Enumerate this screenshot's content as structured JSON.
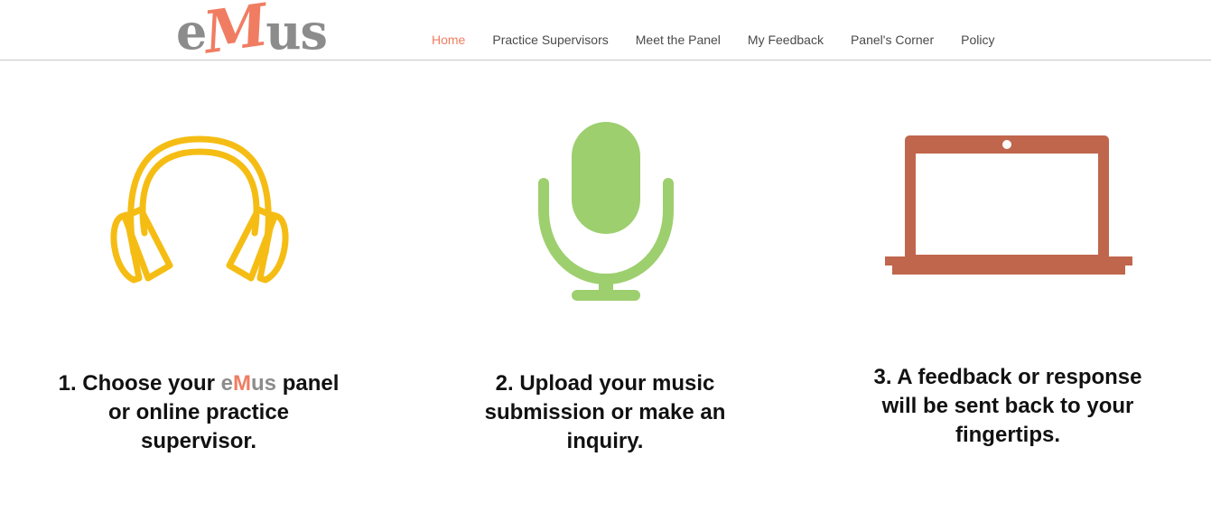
{
  "logo": {
    "part1": "e",
    "part2": "M",
    "part3": "us"
  },
  "nav": {
    "items": [
      {
        "label": "Home",
        "active": true
      },
      {
        "label": "Practice Supervisors"
      },
      {
        "label": "Meet the Panel"
      },
      {
        "label": "My Feedback"
      },
      {
        "label": "Panel's Corner"
      },
      {
        "label": "Policy"
      }
    ]
  },
  "colors": {
    "accent": "#f07d62",
    "grey": "#8c8c8c",
    "headphones": "#f5bd14",
    "microphone": "#9dcf6e",
    "laptop": "#c0664c"
  },
  "steps": [
    {
      "icon": "headphones-icon",
      "prefix": "1. Choose your ",
      "brand_e": "e",
      "brand_m": "M",
      "brand_us": "us",
      "suffix": " panel",
      "line2": "or online practice",
      "line3": "supervisor."
    },
    {
      "icon": "microphone-icon",
      "line1": "2. Upload your music",
      "line2": "submission or make an",
      "line3": "inquiry."
    },
    {
      "icon": "laptop-icon",
      "line1": "3. A feedback or response",
      "line2": "will be sent back to your",
      "line3": "fingertips."
    }
  ]
}
